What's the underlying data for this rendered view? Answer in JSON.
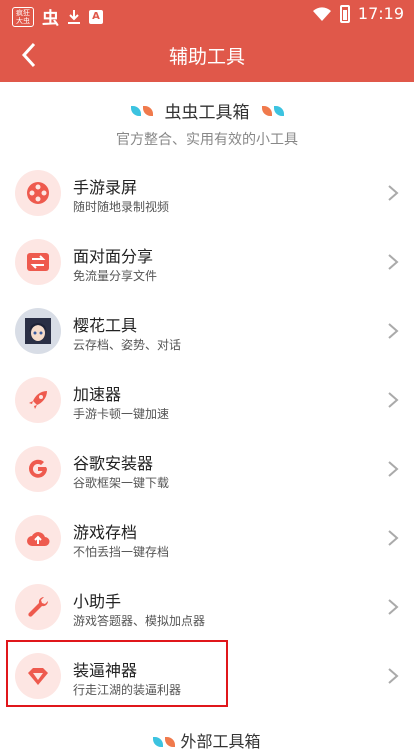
{
  "status_bar": {
    "badge_line1": "疯狂",
    "badge_line2": "大虫",
    "app_glyph": "虫",
    "time": "17:19"
  },
  "nav": {
    "title": "辅助工具"
  },
  "header": {
    "title": "虫虫工具箱",
    "subtitle": "官方整合、实用有效的小工具"
  },
  "tools": [
    {
      "name": "手游录屏",
      "desc": "随时随地录制视频",
      "icon": "film-reel-icon"
    },
    {
      "name": "面对面分享",
      "desc": "免流量分享文件",
      "icon": "share-exchange-icon"
    },
    {
      "name": "樱花工具",
      "desc": "云存档、姿势、对话",
      "icon": "anime-avatar-icon"
    },
    {
      "name": "加速器",
      "desc": "手游卡顿一键加速",
      "icon": "rocket-icon"
    },
    {
      "name": "谷歌安装器",
      "desc": "谷歌框架一键下载",
      "icon": "google-g-icon"
    },
    {
      "name": "游戏存档",
      "desc": "不怕丢挡一键存档",
      "icon": "cloud-upload-icon"
    },
    {
      "name": "小助手",
      "desc": "游戏答题器、模拟加点器",
      "icon": "wrench-icon"
    },
    {
      "name": "装逼神器",
      "desc": "行走江湖的装逼利器",
      "icon": "diamond-icon"
    }
  ],
  "footer": {
    "title": "外部工具箱"
  },
  "colors": {
    "brand": "#e0584a",
    "icon_bg": "#fde6e3",
    "highlight": "#e0161b"
  }
}
